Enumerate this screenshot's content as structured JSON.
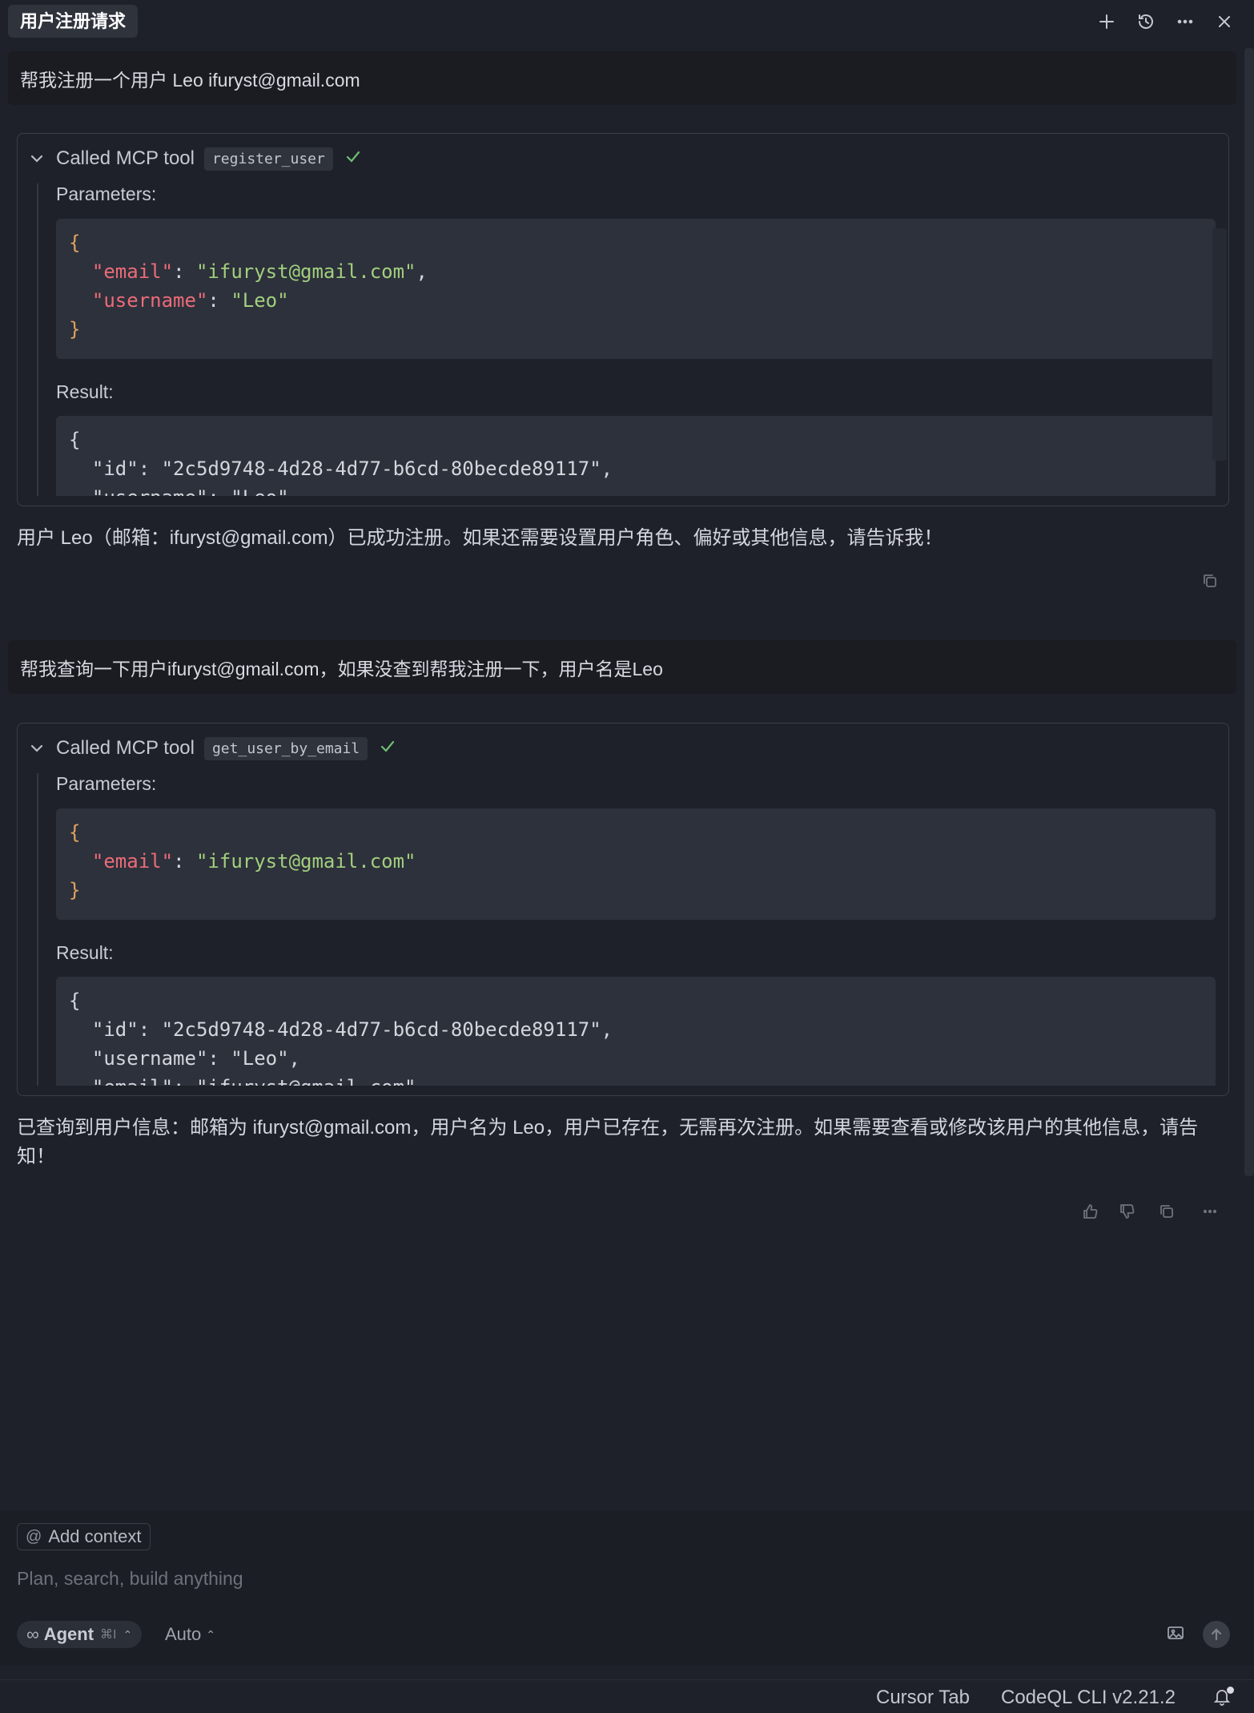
{
  "header": {
    "tab_title": "用户注册请求",
    "icons": [
      "plus-icon",
      "history-icon",
      "more-icon",
      "close-icon"
    ]
  },
  "conversation": {
    "message1": {
      "user": "帮我注册一个用户 Leo ifuryst@gmail.com",
      "tool": {
        "title": "Called MCP tool",
        "name": "register_user",
        "parameters_label": "Parameters:",
        "result_label": "Result:",
        "param_line1": "{",
        "param_key1": "\"email\"",
        "param_val1": "\"ifuryst@gmail.com\"",
        "param_key2": "\"username\"",
        "param_val2": "\"Leo\"",
        "param_line_end": "}",
        "result_line1": "{",
        "result_line2": "  \"id\": \"2c5d9748-4d28-4d77-b6cd-80becde89117\",",
        "result_line3": "  \"username\": \"Leo\","
      },
      "assistant": "用户 Leo（邮箱：ifuryst@gmail.com）已成功注册。如果还需要设置用户角色、偏好或其他信息，请告诉我！"
    },
    "message2": {
      "user": "帮我查询一下用户ifuryst@gmail.com，如果没查到帮我注册一下，用户名是Leo",
      "tool": {
        "title": "Called MCP tool",
        "name": "get_user_by_email",
        "parameters_label": "Parameters:",
        "result_label": "Result:",
        "param_line1": "{",
        "param_key1": "\"email\"",
        "param_val1": "\"ifuryst@gmail.com\"",
        "param_line_end": "}",
        "result_line1": "{",
        "result_line2": "  \"id\": \"2c5d9748-4d28-4d77-b6cd-80becde89117\",",
        "result_line3": "  \"username\": \"Leo\",",
        "result_line4": "  \"email\": \"ifuryst@gmail.com\""
      },
      "assistant": "已查询到用户信息：邮箱为 ifuryst@gmail.com，用户名为 Leo，用户已存在，无需再次注册。如果需要查看或修改该用户的其他信息，请告知！"
    }
  },
  "composer": {
    "add_context": "Add context",
    "placeholder": "Plan, search, build anything",
    "mode_label": "Agent",
    "mode_shortcut": "⌘I",
    "model_label": "Auto"
  },
  "status_bar": {
    "cursor_tab": "Cursor Tab",
    "codeql": "CodeQL CLI v2.21.2"
  }
}
